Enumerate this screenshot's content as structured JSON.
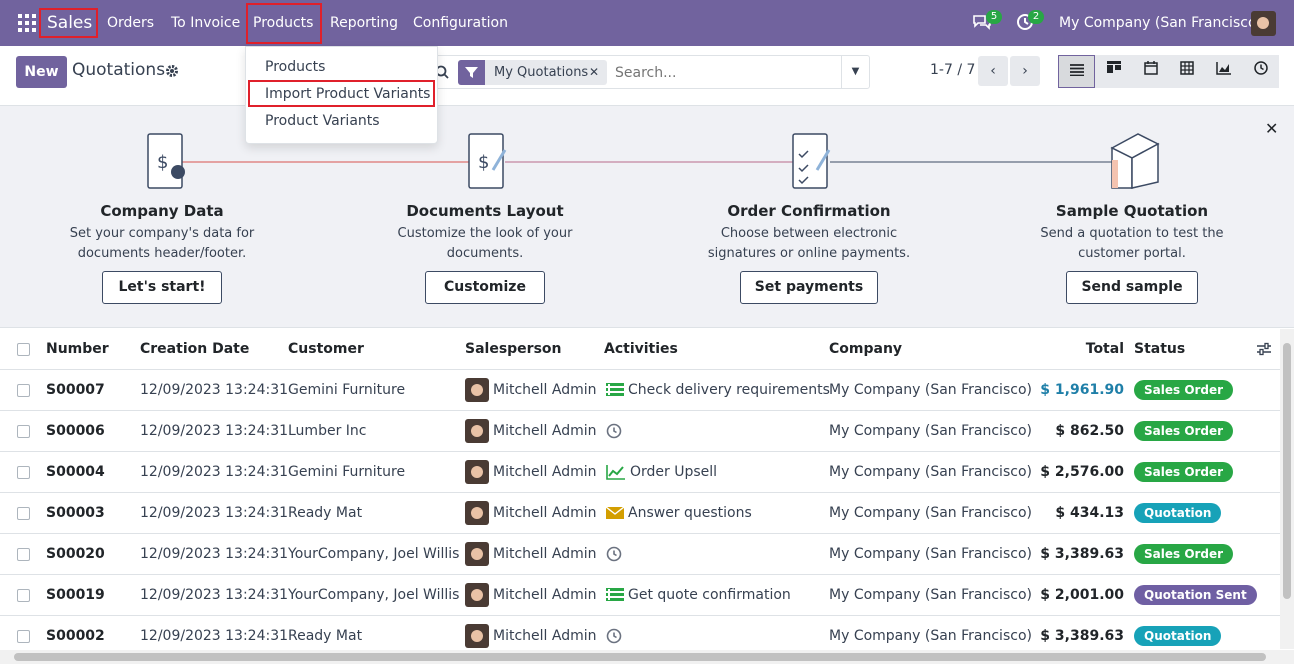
{
  "navbar": {
    "app_name": "Sales",
    "menus": [
      "Orders",
      "To Invoice",
      "Products",
      "Reporting",
      "Configuration"
    ],
    "messages_count": "5",
    "activities_count": "2",
    "company": "My Company (San Francisco)"
  },
  "products_menu": {
    "items": [
      "Products",
      "Import Product Variants",
      "Product Variants"
    ]
  },
  "control_panel": {
    "new_label": "New",
    "title": "Quotations",
    "facet_label": "My Quotations",
    "search_placeholder": "Search...",
    "pager": "1-7 / 7"
  },
  "onboarding": {
    "steps": [
      {
        "title": "Company Data",
        "text": "Set your company's data for documents header/footer.",
        "button": "Let's start!"
      },
      {
        "title": "Documents Layout",
        "text": "Customize the look of your documents.",
        "button": "Customize"
      },
      {
        "title": "Order Confirmation",
        "text": "Choose between electronic signatures or online payments.",
        "button": "Set payments"
      },
      {
        "title": "Sample Quotation",
        "text": "Send a quotation to test the customer portal.",
        "button": "Send sample"
      }
    ]
  },
  "table": {
    "headers": [
      "Number",
      "Creation Date",
      "Customer",
      "Salesperson",
      "Activities",
      "Company",
      "Total",
      "Status"
    ],
    "rows": [
      {
        "number": "S00007",
        "date": "12/09/2023 13:24:31",
        "customer": "Gemini Furniture",
        "salesperson": "Mitchell Admin",
        "activity": "Check delivery requirements",
        "activity_icon": "list-icon",
        "company": "My Company (San Francisco)",
        "total": "$ 1,961.90",
        "status": "Sales Order"
      },
      {
        "number": "S00006",
        "date": "12/09/2023 13:24:31",
        "customer": "Lumber Inc",
        "salesperson": "Mitchell Admin",
        "activity": "",
        "activity_icon": "clock-icon",
        "company": "My Company (San Francisco)",
        "total": "$ 862.50",
        "status": "Sales Order"
      },
      {
        "number": "S00004",
        "date": "12/09/2023 13:24:31",
        "customer": "Gemini Furniture",
        "salesperson": "Mitchell Admin",
        "activity": "Order Upsell",
        "activity_icon": "chart-icon",
        "company": "My Company (San Francisco)",
        "total": "$ 2,576.00",
        "status": "Sales Order"
      },
      {
        "number": "S00003",
        "date": "12/09/2023 13:24:31",
        "customer": "Ready Mat",
        "salesperson": "Mitchell Admin",
        "activity": "Answer questions",
        "activity_icon": "envelope-icon",
        "company": "My Company (San Francisco)",
        "total": "$ 434.13",
        "status": "Quotation"
      },
      {
        "number": "S00020",
        "date": "12/09/2023 13:24:31",
        "customer": "YourCompany, Joel Willis",
        "salesperson": "Mitchell Admin",
        "activity": "",
        "activity_icon": "clock-icon",
        "company": "My Company (San Francisco)",
        "total": "$ 3,389.63",
        "status": "Sales Order"
      },
      {
        "number": "S00019",
        "date": "12/09/2023 13:24:31",
        "customer": "YourCompany, Joel Willis",
        "salesperson": "Mitchell Admin",
        "activity": "Get quote confirmation",
        "activity_icon": "list-icon",
        "company": "My Company (San Francisco)",
        "total": "$ 2,001.00",
        "status": "Quotation Sent"
      },
      {
        "number": "S00002",
        "date": "12/09/2023 13:24:31",
        "customer": "Ready Mat",
        "salesperson": "Mitchell Admin",
        "activity": "",
        "activity_icon": "clock-icon",
        "company": "My Company (San Francisco)",
        "total": "$ 3,389.63",
        "status": "Quotation"
      }
    ]
  },
  "colors": {
    "brand": "#71639e",
    "sales_order": "#28a745",
    "quotation": "#17a2b8",
    "quotation_sent": "#6f5fa3",
    "highlight_border": "#e0202b"
  }
}
